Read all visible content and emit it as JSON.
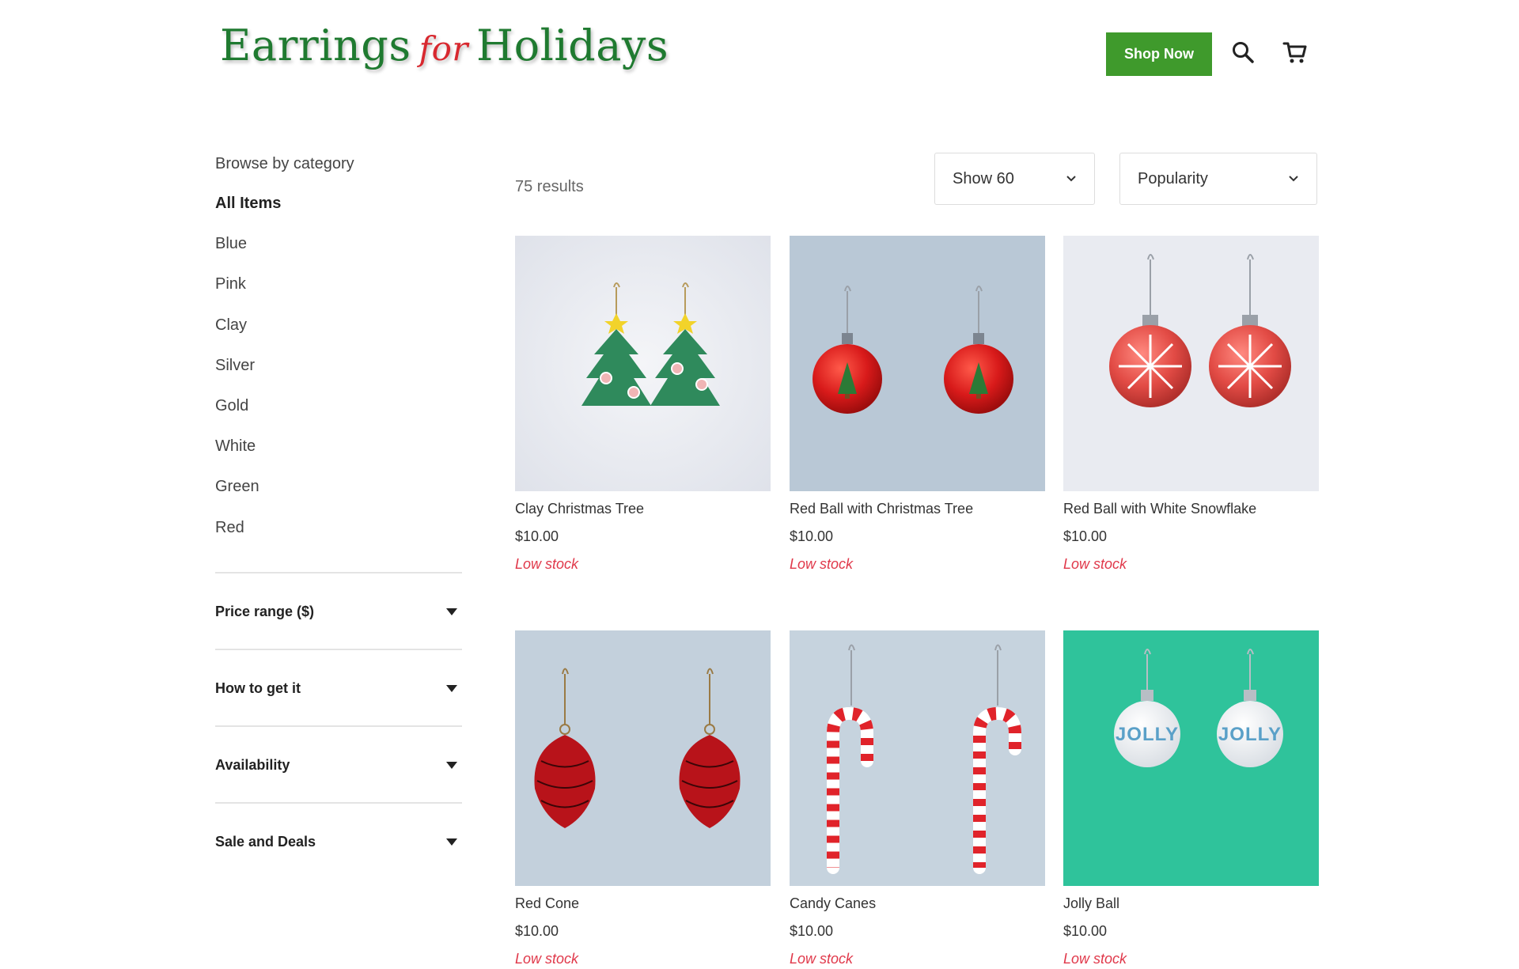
{
  "header": {
    "logo": {
      "part1": "Earrings",
      "part2": "for",
      "part3": "Holidays"
    },
    "shop_now_label": "Shop Now",
    "icons": [
      "search-icon",
      "cart-icon"
    ],
    "colors": {
      "brand_green": "#1f7a30",
      "brand_red": "#d8282f",
      "button_green": "#3f9a2c"
    }
  },
  "sidebar": {
    "browse_title": "Browse by category",
    "categories": [
      {
        "label": "All Items",
        "active": true
      },
      {
        "label": "Blue"
      },
      {
        "label": "Pink"
      },
      {
        "label": "Clay"
      },
      {
        "label": "Silver"
      },
      {
        "label": "Gold"
      },
      {
        "label": "White"
      },
      {
        "label": "Green"
      },
      {
        "label": "Red"
      }
    ],
    "filters": [
      {
        "label": "Price range ($)",
        "icon": "caret-down-icon"
      },
      {
        "label": "How to get it",
        "icon": "caret-down-icon"
      },
      {
        "label": "Availability",
        "icon": "caret-down-icon"
      },
      {
        "label": "Sale and Deals",
        "icon": "caret-down-icon"
      }
    ]
  },
  "toolbar": {
    "results_count": "75 results",
    "show_select": {
      "value": "Show 60",
      "icon": "chevron-down-icon"
    },
    "sort_select": {
      "value": "Popularity",
      "icon": "chevron-down-icon"
    }
  },
  "products": [
    {
      "name": "Clay Christmas Tree",
      "price": "$10.00",
      "stock": "Low stock"
    },
    {
      "name": "Red Ball with Christmas Tree",
      "price": "$10.00",
      "stock": "Low stock"
    },
    {
      "name": "Red Ball with White Snowflake",
      "price": "$10.00",
      "stock": "Low stock"
    },
    {
      "name": "Red Cone",
      "price": "$10.00",
      "stock": "Low stock"
    },
    {
      "name": "Candy Canes",
      "price": "$10.00",
      "stock": "Low stock"
    },
    {
      "name": "Jolly Ball",
      "price": "$10.00",
      "stock": "Low stock"
    }
  ],
  "ornament_text": "JOLLY",
  "stock_color": "#e0384a"
}
